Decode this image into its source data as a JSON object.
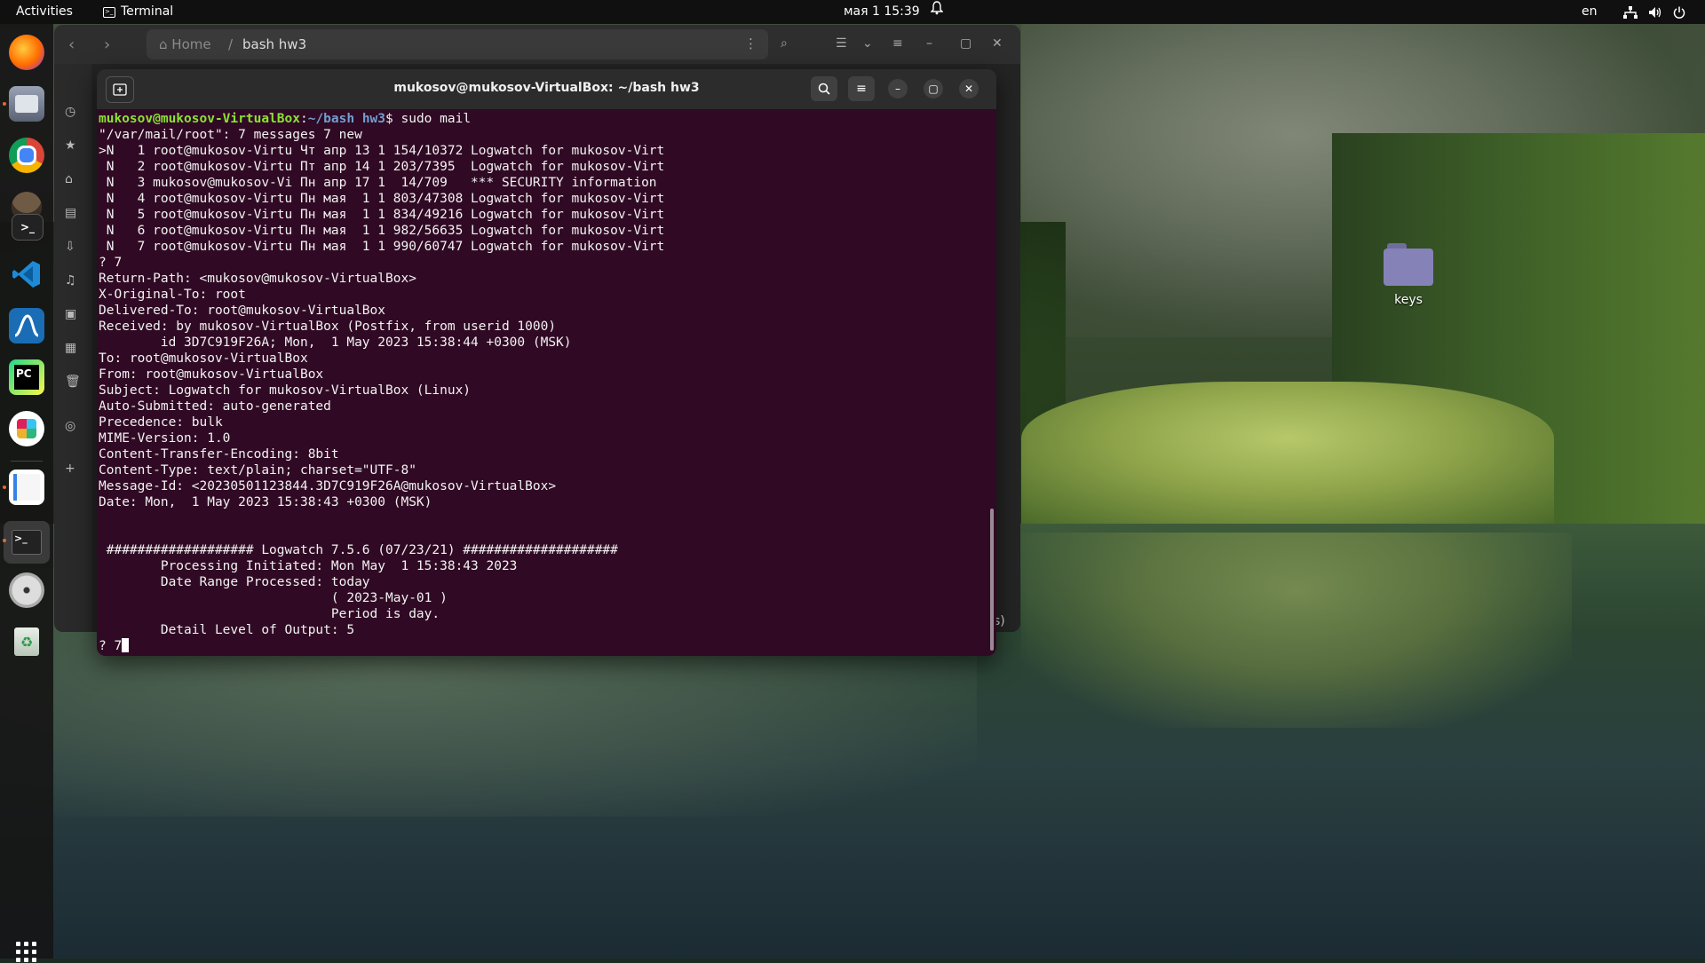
{
  "topbar": {
    "activities": "Activities",
    "app_name": "Terminal",
    "clock": "мая 1  15:39",
    "language": "en"
  },
  "desktop": {
    "folder_label": "keys"
  },
  "files_window": {
    "path_home": "Home",
    "path_separator": "/",
    "path_current": "bash hw3",
    "peek_text": "s)"
  },
  "terminal": {
    "title": "mukosov@mukosov-VirtualBox: ~/bash hw3",
    "prompt_user": "mukosov@mukosov-VirtualBox",
    "prompt_sep": ":",
    "prompt_path": "~/bash hw3",
    "prompt_cmd": "$ sudo mail",
    "lines": [
      "\"/var/mail/root\": 7 messages 7 new",
      ">N   1 root@mukosov-Virtu Чт апр 13 1 154/10372 Logwatch for mukosov-Virt",
      " N   2 root@mukosov-Virtu Пт апр 14 1 203/7395  Logwatch for mukosov-Virt",
      " N   3 mukosov@mukosov-Vi Пн апр 17 1  14/709   *** SECURITY information",
      " N   4 root@mukosov-Virtu Пн мая  1 1 803/47308 Logwatch for mukosov-Virt",
      " N   5 root@mukosov-Virtu Пн мая  1 1 834/49216 Logwatch for mukosov-Virt",
      " N   6 root@mukosov-Virtu Пн мая  1 1 982/56635 Logwatch for mukosov-Virt",
      " N   7 root@mukosov-Virtu Пн мая  1 1 990/60747 Logwatch for mukosov-Virt",
      "? 7",
      "Return-Path: <mukosov@mukosov-VirtualBox>",
      "X-Original-To: root",
      "Delivered-To: root@mukosov-VirtualBox",
      "Received: by mukosov-VirtualBox (Postfix, from userid 1000)",
      "        id 3D7C919F26A; Mon,  1 May 2023 15:38:44 +0300 (MSK)",
      "To: root@mukosov-VirtualBox",
      "From: root@mukosov-VirtualBox",
      "Subject: Logwatch for mukosov-VirtualBox (Linux)",
      "Auto-Submitted: auto-generated",
      "Precedence: bulk",
      "MIME-Version: 1.0",
      "Content-Transfer-Encoding: 8bit",
      "Content-Type: text/plain; charset=\"UTF-8\"",
      "Message-Id: <20230501123844.3D7C919F26A@mukosov-VirtualBox>",
      "Date: Mon,  1 May 2023 15:38:43 +0300 (MSK)",
      "",
      "",
      " ################### Logwatch 7.5.6 (07/23/21) ####################",
      "        Processing Initiated: Mon May  1 15:38:43 2023",
      "        Date Range Processed: today",
      "                              ( 2023-May-01 )",
      "                              Period is day.",
      "        Detail Level of Output: 5"
    ],
    "final_prompt": "? 7"
  },
  "dock": {
    "items": [
      "firefox-icon",
      "files-icon",
      "chrome-icon",
      "gimp-icon",
      "terminal-app-icon",
      "vscode-icon",
      "wireshark-icon",
      "pycharm-icon",
      "slack-icon",
      "text-editor-icon",
      "terminal-running-icon",
      "disc-icon",
      "trash-icon"
    ]
  },
  "colors": {
    "terminal_bg": "#300a24",
    "prompt_user": "#8ae234",
    "prompt_path": "#729fcf",
    "topbar_bg": "#101010"
  }
}
